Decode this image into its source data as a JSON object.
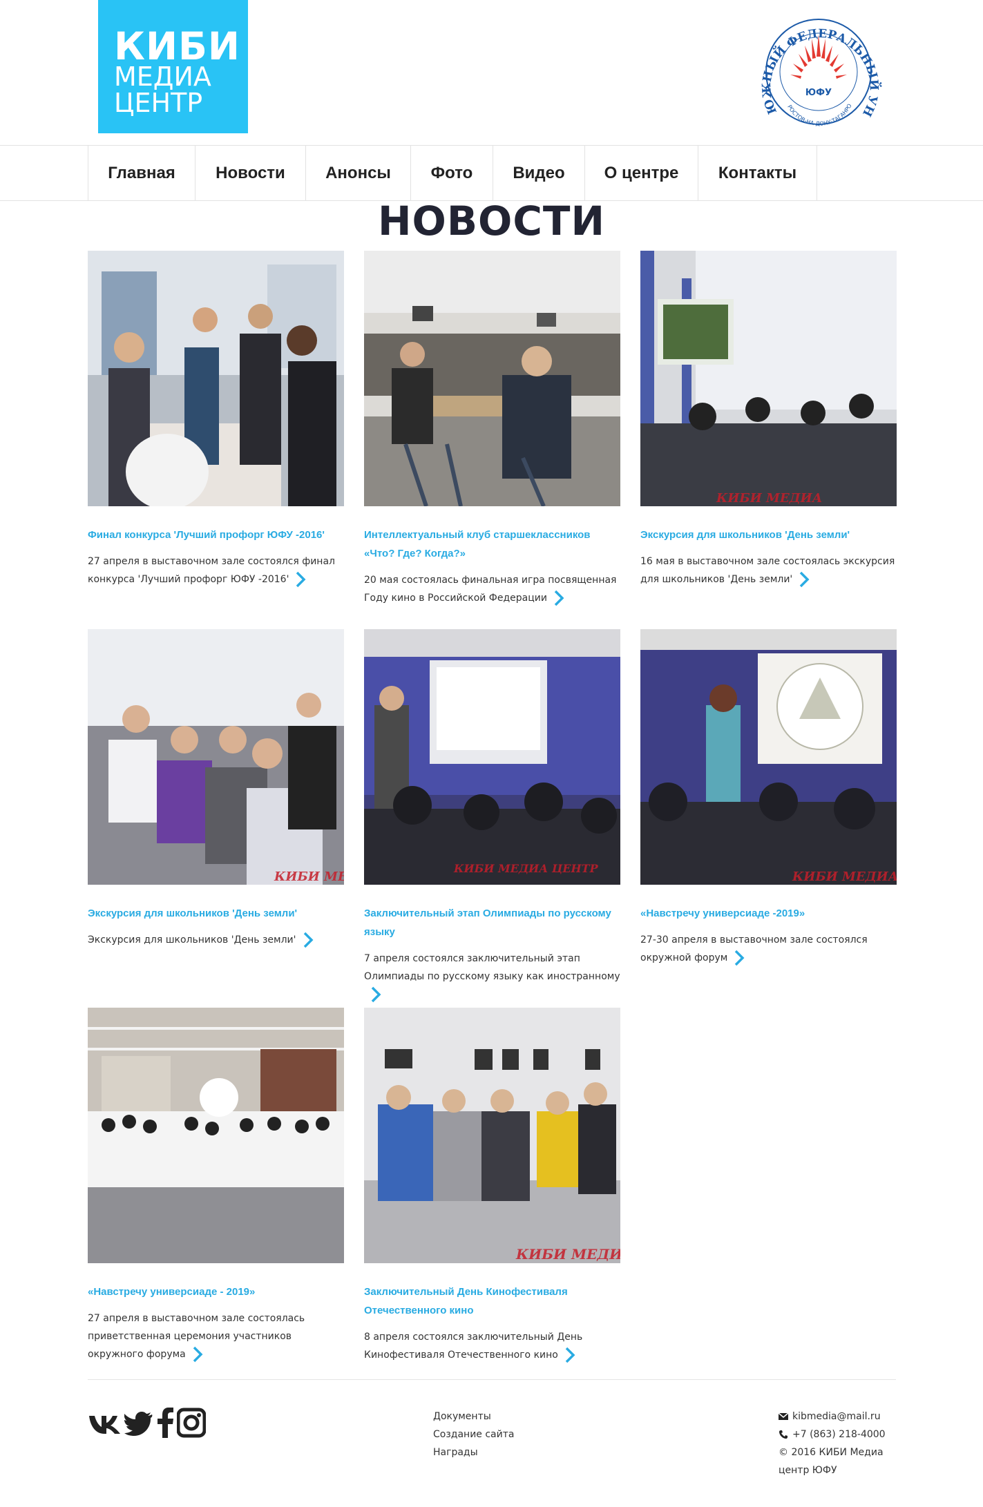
{
  "logo": {
    "line1": "КИБИ",
    "line2": "МЕДИА",
    "line3": "ЦЕНТР"
  },
  "univ_logo": {
    "ring_text": "ЮЖНЫЙ ФЕДЕРАЛЬНЫЙ УНИВЕРСИТЕТ",
    "inner_text": "РОСТОВ-НА-ДОНУ·ТАГАНРОГ",
    "center_text": "ЮФУ"
  },
  "nav": {
    "items": [
      "Главная",
      "Новости",
      "Анонсы",
      "Фото",
      "Видео",
      "О центре",
      "Контакты"
    ]
  },
  "page_title": "НОВОСТИ",
  "news": [
    {
      "title": "Финал конкурса 'Лучший профорг ЮФУ -2016'",
      "text": "27 апреля в выставочном зале состоялся финал конкурса 'Лучший профорг ЮФУ -2016'"
    },
    {
      "title": "Интеллектуальный клуб старшеклассников «Что? Где? Когда?»",
      "text": "20 мая состоялась финальная игра посвященная Году кино в Российской Федерации"
    },
    {
      "title": "Экскурсия для школьников 'День земли'",
      "text": "16 мая в выставочном зале состоялась экскурсия для школьников 'День земли'"
    },
    {
      "title": "Экскурсия для школьников 'День земли'",
      "text": "Экскурсия для школьников 'День земли'"
    },
    {
      "title": "Заключительный этап Олимпиады по русскому языку",
      "text": "7 апреля состоялся заключительный этап Олимпиады по русскому языку как иностранному"
    },
    {
      "title": "«Навстречу универсиаде -2019»",
      "text": "27-30 апреля в выставочном зале состоялся окружной форум"
    },
    {
      "title": "«Навстречу универсиаде - 2019»",
      "text": "27 апреля в выставочном зале состоялась приветственная церемония участников окружного форума"
    },
    {
      "title": "Заключительный День Кинофестиваля Отечественного кино",
      "text": "8 апреля состоялся заключительный День Кинофестиваля Отечественного кино"
    }
  ],
  "photo_watermarks": {
    "w3": "КИБИ МЕДИА",
    "w4": "КИБИ МЕ",
    "w5": "КИБИ МЕДИА ЦЕНТР",
    "w6": "КИБИ МЕДИА",
    "w8": "КИБИ МЕДИА"
  },
  "footer": {
    "links": [
      "Документы",
      "Создание сайта",
      "Награды"
    ],
    "email": "kibmedia@mail.ru",
    "phone": "+7 (863) 218-4000",
    "copyright": "© 2016 КИБИ Медиа центр ЮФУ"
  },
  "colors": {
    "accent": "#29c3f5",
    "link": "#29abe2",
    "title": "#222433"
  }
}
